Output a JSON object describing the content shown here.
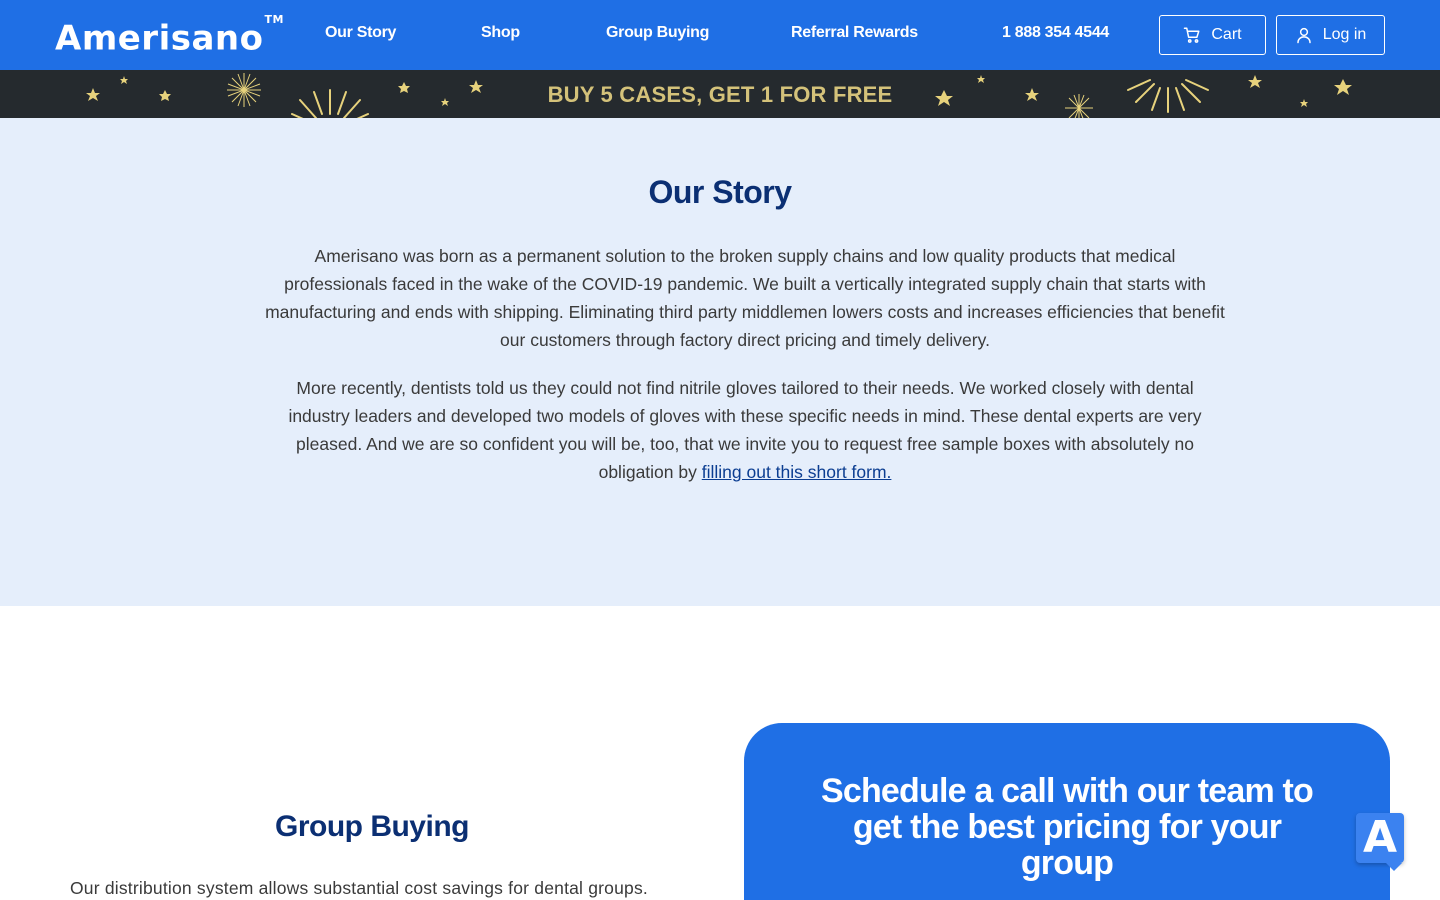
{
  "header": {
    "logo": "Amerisano",
    "logo_tm": "TM",
    "nav": {
      "our_story": "Our Story",
      "shop": "Shop",
      "group_buying": "Group Buying",
      "referral_rewards": "Referral Rewards",
      "phone": "1 888 354 4544"
    },
    "cart_label": "Cart",
    "login_label": "Log in"
  },
  "promo": {
    "text": "BUY 5 CASES, GET 1 FOR FREE"
  },
  "story": {
    "title": "Our Story",
    "paragraph1": "Amerisano was born as a permanent solution to the broken supply chains and low quality products that medical professionals faced in the wake of the COVID-19 pandemic. We built a vertically integrated supply chain that starts with manufacturing and ends with shipping. Eliminating third party middlemen lowers costs and increases efficiencies that benefit our customers through factory direct pricing and timely delivery.",
    "paragraph2": "More recently, dentists told us they could not find nitrile gloves tailored to their needs. We worked closely with dental industry leaders and developed two models of gloves with these specific needs in mind. These dental experts are very pleased. And we are so confident you will be, too, that we invite you to request free sample boxes with absolutely no obligation by",
    "form_link": "filling out this short form."
  },
  "group_buying": {
    "title": "Group Buying",
    "text": "Our distribution system allows substantial cost savings for dental groups."
  },
  "cta": {
    "title": "Schedule a call with our team to get the best pricing for your group"
  },
  "widget": {
    "label": "A"
  },
  "colors": {
    "brand_blue": "#1f6fe5",
    "navy": "#0b2f73",
    "story_bg": "#e5eefb",
    "promo_bg": "#252a2e",
    "promo_gold": "#d4c27a"
  },
  "icons": {
    "cart": "cart-icon",
    "login": "user-icon"
  }
}
